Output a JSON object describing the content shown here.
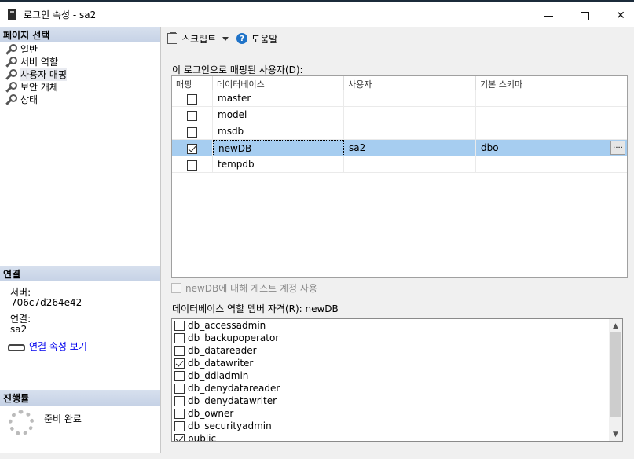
{
  "window": {
    "title": "로그인 속성 - sa2",
    "minimize": "—",
    "maximize": "□",
    "close": "✕"
  },
  "sidebar": {
    "pages_header": "페이지 선택",
    "items": [
      "일반",
      "서버 역할",
      "사용자 매핑",
      "보안 개체",
      "상태"
    ],
    "active_index": 2,
    "connection_header": "연결",
    "server_label": "서버:",
    "server_value": "706c7d264e42",
    "connection_label": "연결:",
    "connection_value": "sa2",
    "view_connection_link": "연결 속성 보기",
    "progress_header": "진행률",
    "progress_status": "준비 완료"
  },
  "toolbar": {
    "script_label": "스크립트",
    "help_label": "도움말"
  },
  "mapping": {
    "label": "이 로그인으로 매핑된 사용자(D):",
    "columns": [
      "매핑",
      "데이터베이스",
      "사용자",
      "기본 스키마"
    ],
    "rows": [
      {
        "mapped": false,
        "database": "master",
        "user": "",
        "schema": ""
      },
      {
        "mapped": false,
        "database": "model",
        "user": "",
        "schema": ""
      },
      {
        "mapped": false,
        "database": "msdb",
        "user": "",
        "schema": ""
      },
      {
        "mapped": true,
        "database": "newDB",
        "user": "sa2",
        "schema": "dbo",
        "selected": true
      },
      {
        "mapped": false,
        "database": "tempdb",
        "user": "",
        "schema": ""
      }
    ],
    "ellipsis": "...."
  },
  "guest_option": "newDB에 대해 게스트 계정 사용",
  "roles": {
    "label": "데이터베이스 역할 멤버 자격(R): newDB",
    "items": [
      {
        "name": "db_accessadmin",
        "checked": false
      },
      {
        "name": "db_backupoperator",
        "checked": false
      },
      {
        "name": "db_datareader",
        "checked": false
      },
      {
        "name": "db_datawriter",
        "checked": true
      },
      {
        "name": "db_ddladmin",
        "checked": false
      },
      {
        "name": "db_denydatareader",
        "checked": false
      },
      {
        "name": "db_denydatawriter",
        "checked": false
      },
      {
        "name": "db_owner",
        "checked": false
      },
      {
        "name": "db_securityadmin",
        "checked": false
      },
      {
        "name": "public",
        "checked": true
      }
    ]
  },
  "colors": {
    "selection": "#a6cdf0",
    "section_header": "#c6d2e6",
    "link": "#0000ee"
  }
}
